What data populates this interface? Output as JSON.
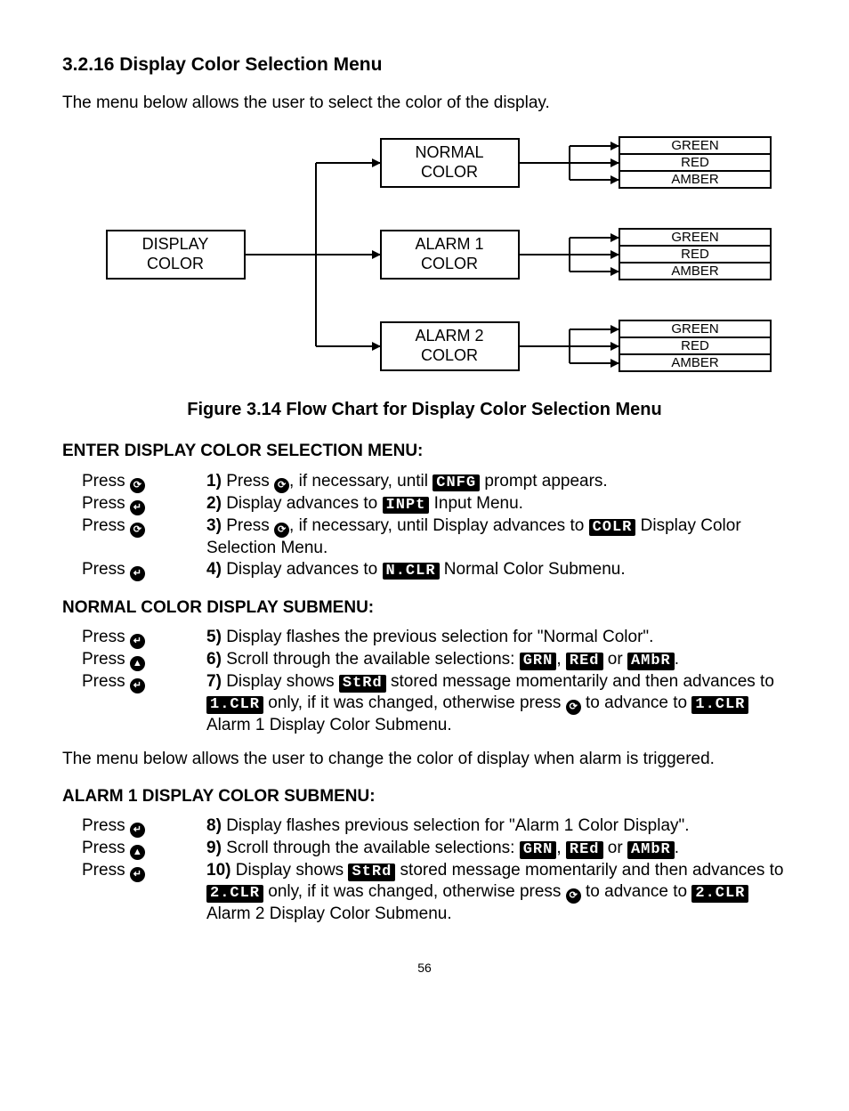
{
  "title": "3.2.16 Display Color Selection Menu",
  "intro": "The menu below allows the user to select the color of the display.",
  "caption": "Figure 3.14 Flow Chart for Display Color Selection Menu",
  "flow": {
    "root": "DISPLAY COLOR",
    "mid": [
      "NORMAL COLOR",
      "ALARM 1 COLOR",
      "ALARM 2 COLOR"
    ],
    "leaf": [
      "GREEN",
      "RED",
      "AMBER"
    ]
  },
  "sections": {
    "enter": {
      "heading": "ENTER DISPLAY COLOR SELECTION MENU:",
      "steps": [
        {
          "press": "Press",
          "icon": "menu",
          "n": "1)",
          "a": "Press ",
          "icon2": "menu",
          "b": ", if necessary, until ",
          "seg": "CNFG",
          "c": " prompt appears."
        },
        {
          "press": "Press",
          "icon": "enter",
          "n": "2)",
          "a": "Display advances to ",
          "seg": "INPt",
          "c": " Input Menu."
        },
        {
          "press": "Press",
          "icon": "menu",
          "n": "3)",
          "a": "Press ",
          "icon2": "menu",
          "b": ", if necessary, until Display advances to ",
          "seg": "COLR",
          "c": " Display Color Selection Menu.",
          "wrap": true
        },
        {
          "press": "Press",
          "icon": "enter",
          "n": "4)",
          "a": "Display advances to ",
          "seg": "N.CLR",
          "c": " Normal Color Submenu."
        }
      ]
    },
    "normal": {
      "heading": "NORMAL COLOR DISPLAY SUBMENU:",
      "steps": [
        {
          "press": "Press",
          "icon": "enter",
          "n": "5)",
          "a": "Display flashes the previous selection for \"Normal Color\"."
        },
        {
          "press": "Press",
          "icon": "up",
          "n": "6)",
          "a": "Scroll through the available selections: ",
          "seg": "GRN",
          "b": ", ",
          "seg2": "REd",
          "c": " or ",
          "seg3": "AMbR",
          "d": "."
        },
        {
          "press": "Press",
          "icon": "enter",
          "n": "7)",
          "a": "Display shows ",
          "seg": "StRd",
          "b": " stored message momentarily and then advances to ",
          "seg2": "1.CLR",
          "c": " only, if it was changed, otherwise press ",
          "icon2": "menu",
          "d": " to advance to ",
          "seg3": "1.CLR",
          "e": " Alarm 1 Display Color Submenu."
        }
      ]
    },
    "note": "The menu below allows the user to change the color of display when alarm is triggered.",
    "alarm1": {
      "heading": "ALARM 1 DISPLAY COLOR SUBMENU:",
      "steps": [
        {
          "press": "Press",
          "icon": "enter",
          "n": "8)",
          "a": "Display flashes previous selection for \"Alarm 1 Color Display\"."
        },
        {
          "press": "Press",
          "icon": "up",
          "n": "9)",
          "a": "Scroll through the available selections: ",
          "seg": "GRN",
          "b": ", ",
          "seg2": "REd",
          "c": " or ",
          "seg3": "AMbR",
          "d": "."
        },
        {
          "press": "Press",
          "icon": "enter",
          "n": "10)",
          "a": "Display shows ",
          "seg": "StRd",
          "b": " stored message momentarily and then advances to ",
          "seg2": "2.CLR",
          "c": " only, if it was changed, otherwise press ",
          "icon2": "menu",
          "d": " to advance to ",
          "seg3": "2.CLR",
          "e": " Alarm 2 Display Color Submenu."
        }
      ]
    }
  },
  "icons": {
    "menu": "⟳",
    "enter": "↵",
    "up": "▲"
  },
  "page": "56"
}
